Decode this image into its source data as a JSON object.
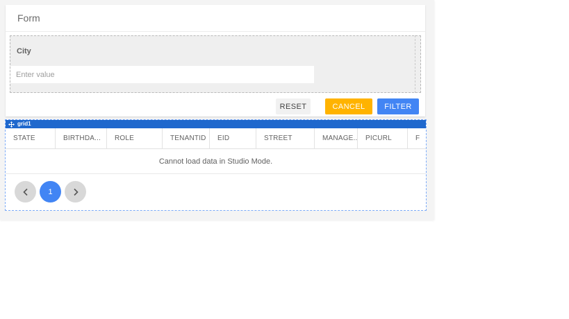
{
  "form": {
    "title": "Form",
    "fields": [
      {
        "label": "City",
        "placeholder": "Enter value",
        "value": ""
      }
    ],
    "buttons": [
      {
        "name": "reset",
        "label": "RESET"
      },
      {
        "name": "cancel",
        "label": "CANCEL"
      },
      {
        "name": "filter",
        "label": "FILTER"
      }
    ]
  },
  "grid": {
    "widget_label": "grid1",
    "move_icon": "move-icon",
    "columns": [
      {
        "label": "STATE",
        "width": 72
      },
      {
        "label": "BIRTHDA...",
        "width": 74
      },
      {
        "label": "ROLE",
        "width": 80
      },
      {
        "label": "TENANTID",
        "width": 68
      },
      {
        "label": "EID",
        "width": 67
      },
      {
        "label": "STREET",
        "width": 84
      },
      {
        "label": "MANAGE...",
        "width": 62
      },
      {
        "label": "PICURL",
        "width": 72
      },
      {
        "label": "F",
        "width": 0
      }
    ],
    "empty_message": "Cannot load data in Studio Mode.",
    "pagination": {
      "prev_icon": "chevron-left",
      "current_page": "1",
      "next_icon": "chevron-right"
    }
  },
  "colors": {
    "primary_blue": "#4285f4",
    "amber": "#ffb300",
    "grid_titlebar_blue": "#1f68cd",
    "selection_dashed_gray": "#b9b9b9",
    "selection_dashed_blue": "#7baaf7"
  }
}
